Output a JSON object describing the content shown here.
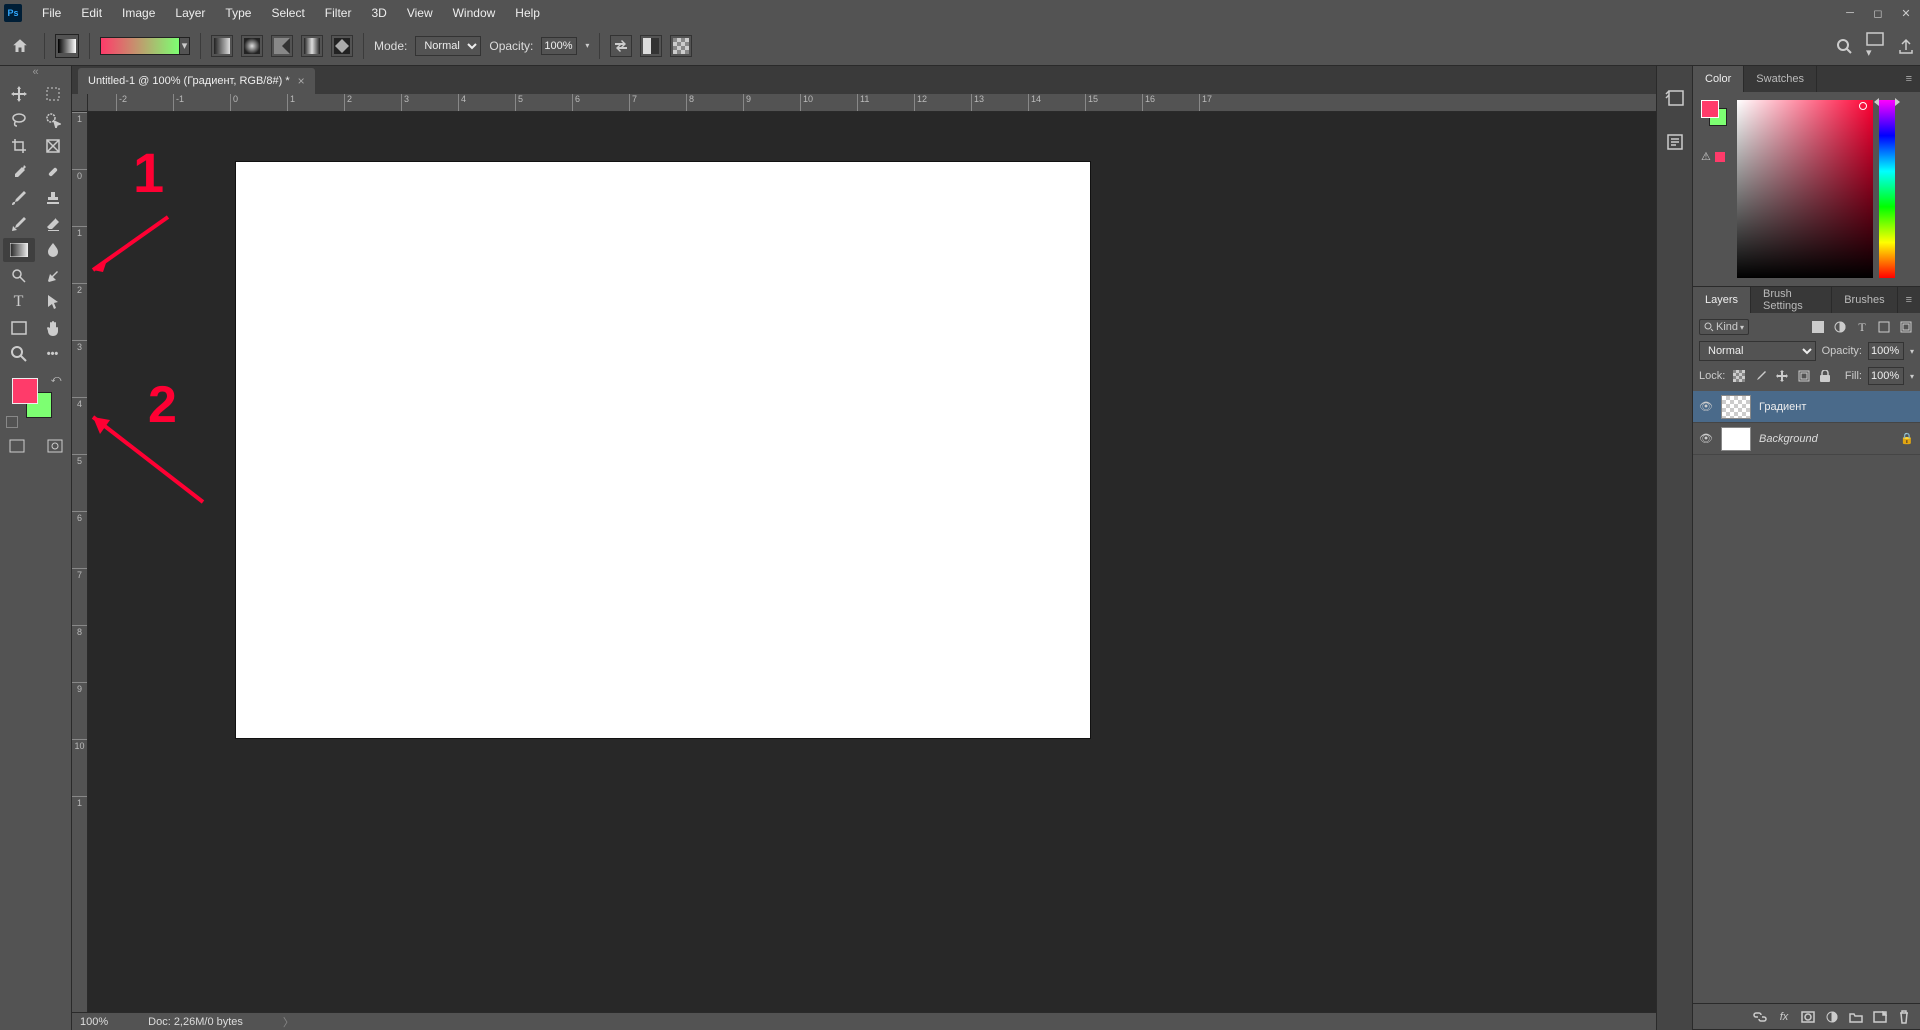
{
  "menubar": {
    "items": [
      "File",
      "Edit",
      "Image",
      "Layer",
      "Type",
      "Select",
      "Filter",
      "3D",
      "View",
      "Window",
      "Help"
    ]
  },
  "optionsbar": {
    "mode_label": "Mode:",
    "mode_value": "Normal",
    "opacity_label": "Opacity:",
    "opacity_value": "100%"
  },
  "document": {
    "tab_title": "Untitled-1 @ 100% (Градиент, RGB/8#) *",
    "zoom": "100%",
    "doc_info": "Doc: 2,26M/0 bytes",
    "ruler_h": [
      "-2",
      "-1",
      "0",
      "1",
      "2",
      "3",
      "4",
      "5",
      "6",
      "7",
      "8",
      "9",
      "10",
      "11",
      "12",
      "13",
      "14",
      "15",
      "16",
      "17"
    ],
    "ruler_v": [
      "1",
      "0",
      "1",
      "2",
      "3",
      "4",
      "5",
      "6",
      "7",
      "8",
      "9",
      "10",
      "1"
    ]
  },
  "colors": {
    "fg": "#ff3b6a",
    "bg": "#7dff72",
    "tabs": {
      "color": "Color",
      "swatches": "Swatches"
    }
  },
  "layers_panel": {
    "tabs": {
      "layers": "Layers",
      "brush_settings": "Brush Settings",
      "brushes": "Brushes"
    },
    "filter_label": "Kind",
    "blend_mode": "Normal",
    "opacity_label": "Opacity:",
    "opacity_value": "100%",
    "lock_label": "Lock:",
    "fill_label": "Fill:",
    "fill_value": "100%",
    "layers": [
      {
        "name": "Градиент",
        "selected": true,
        "checker": true,
        "locked": false
      },
      {
        "name": "Background",
        "selected": false,
        "checker": false,
        "locked": true
      }
    ]
  },
  "annotations": {
    "one": "1",
    "two": "2"
  }
}
